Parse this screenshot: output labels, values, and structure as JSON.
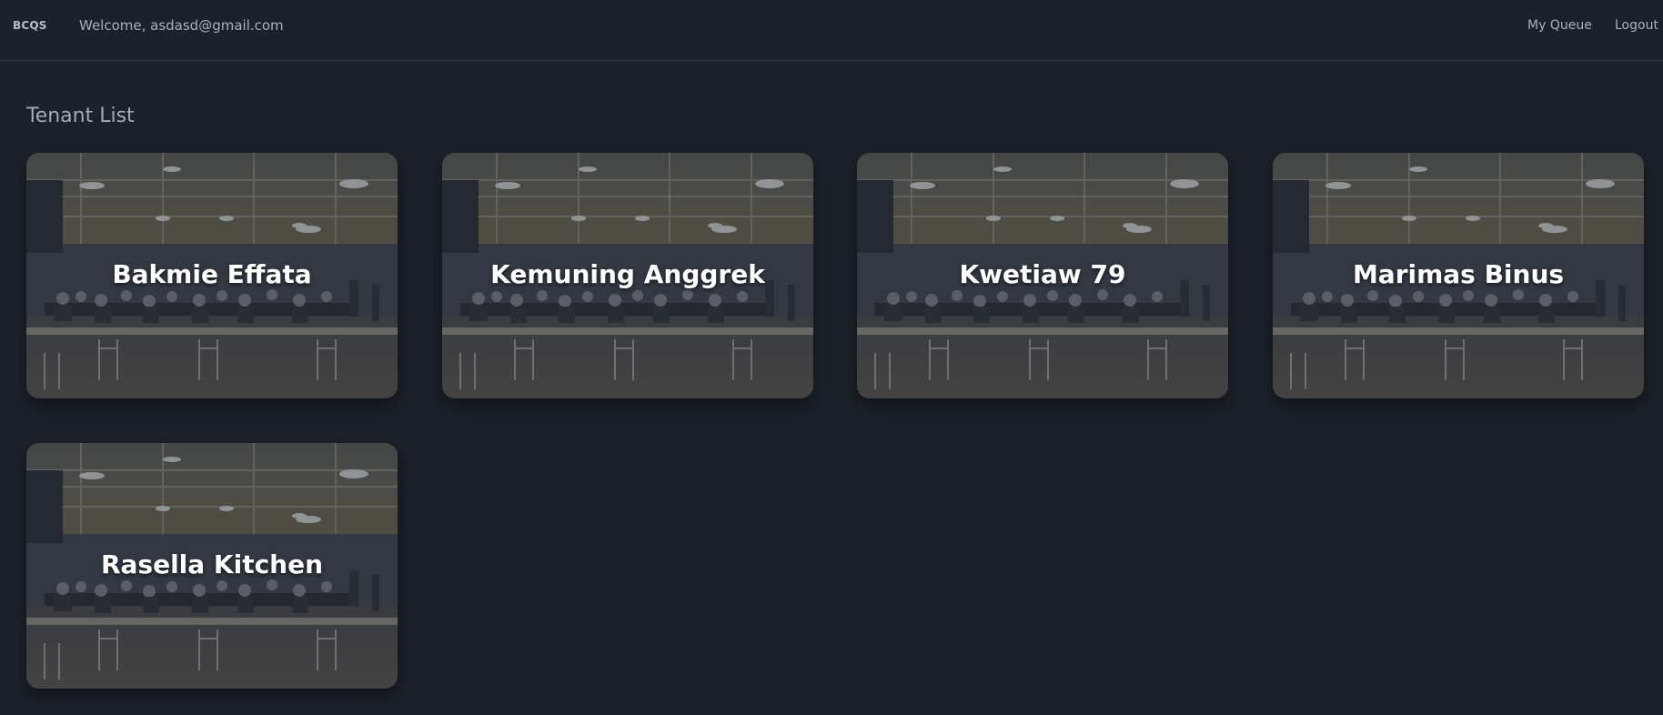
{
  "navbar": {
    "brand": "BCQS",
    "welcome": "Welcome, asdasd@gmail.com",
    "links": [
      "My Queue",
      "Logout"
    ]
  },
  "page": {
    "title": "Tenant List"
  },
  "tenants": [
    {
      "name": "Bakmie Effata"
    },
    {
      "name": "Kemuning Anggrek"
    },
    {
      "name": "Kwetiaw 79"
    },
    {
      "name": "Marimas Binus"
    },
    {
      "name": "Rasella Kitchen"
    }
  ],
  "colors": {
    "background": "#1c212a",
    "card_text": "#ffffff",
    "muted_text": "#aab1bd"
  },
  "icons": {
    "card_background": "cafeteria-photo"
  }
}
